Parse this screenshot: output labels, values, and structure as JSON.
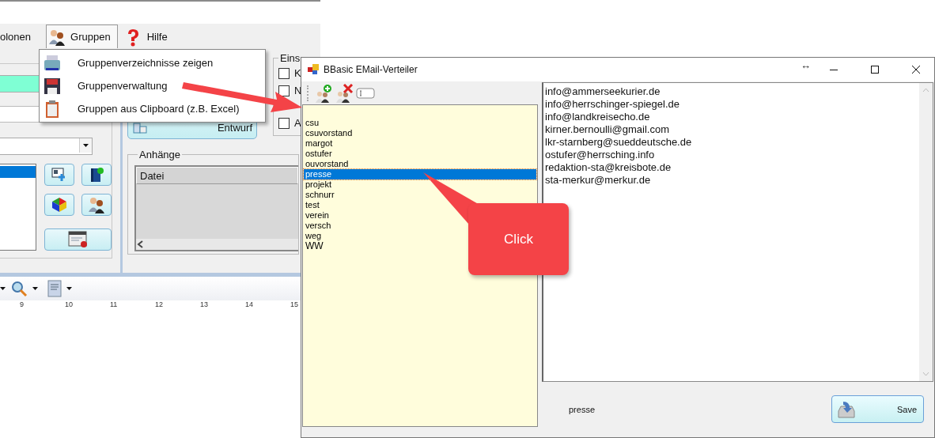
{
  "background_app": {
    "menu_bar": [
      {
        "label": "olonen",
        "selected": false,
        "kind": "text"
      },
      {
        "label": "Gruppen",
        "selected": true,
        "kind": "people"
      },
      {
        "label": "Hilfe",
        "selected": false,
        "kind": "help"
      }
    ],
    "gruppen_menu": [
      {
        "label": "Gruppenverzeichnisse zeigen",
        "kind": "printer"
      },
      {
        "label": "Gruppenverwaltung",
        "kind": "floppy"
      },
      {
        "label": "Gruppen aus Clipboard (z.B. Excel)",
        "kind": "clipboard"
      }
    ],
    "left_list": [
      {
        "selected": true
      }
    ],
    "settings_group": {
      "title": "Eins",
      "checkboxes": [
        {
          "label": "K",
          "checked": false
        },
        {
          "label": "N",
          "checked": false
        },
        {
          "label": "A",
          "checked": false
        }
      ]
    },
    "draft_button": "Entwurf",
    "attachments": {
      "title": "Anhänge",
      "columns": [
        "Datei"
      ]
    },
    "ruler": [
      "9",
      "10",
      "11",
      "12",
      "13",
      "14",
      "15"
    ]
  },
  "dialog": {
    "title": "BBasic EMail-Verteiler",
    "resize_glyph": "↔",
    "groups": [
      {
        "label": "csu",
        "selected": false
      },
      {
        "label": "csuvorstand",
        "selected": false
      },
      {
        "label": "margot",
        "selected": false
      },
      {
        "label": "ostufer",
        "selected": false
      },
      {
        "label": "ouvorstand",
        "selected": false
      },
      {
        "label": "presse",
        "selected": true
      },
      {
        "label": "projekt",
        "selected": false
      },
      {
        "label": "schnurr",
        "selected": false
      },
      {
        "label": "test",
        "selected": false
      },
      {
        "label": "verein",
        "selected": false
      },
      {
        "label": "versch",
        "selected": false
      },
      {
        "label": "weg",
        "selected": false
      },
      {
        "label": "WW",
        "selected": false
      }
    ],
    "emails": [
      "info@ammerseekurier.de",
      "info@herrschinger-spiegel.de",
      "info@landkreisecho.de",
      "kirner.bernoulli@gmail.com",
      "lkr-starnberg@sueddeutsche.de",
      "ostufer@herrsching.info",
      "redaktion-sta@kreisbote.de",
      "sta-merkur@merkur.de"
    ],
    "status": "presse",
    "save_button": "Save"
  },
  "callout": "Click"
}
